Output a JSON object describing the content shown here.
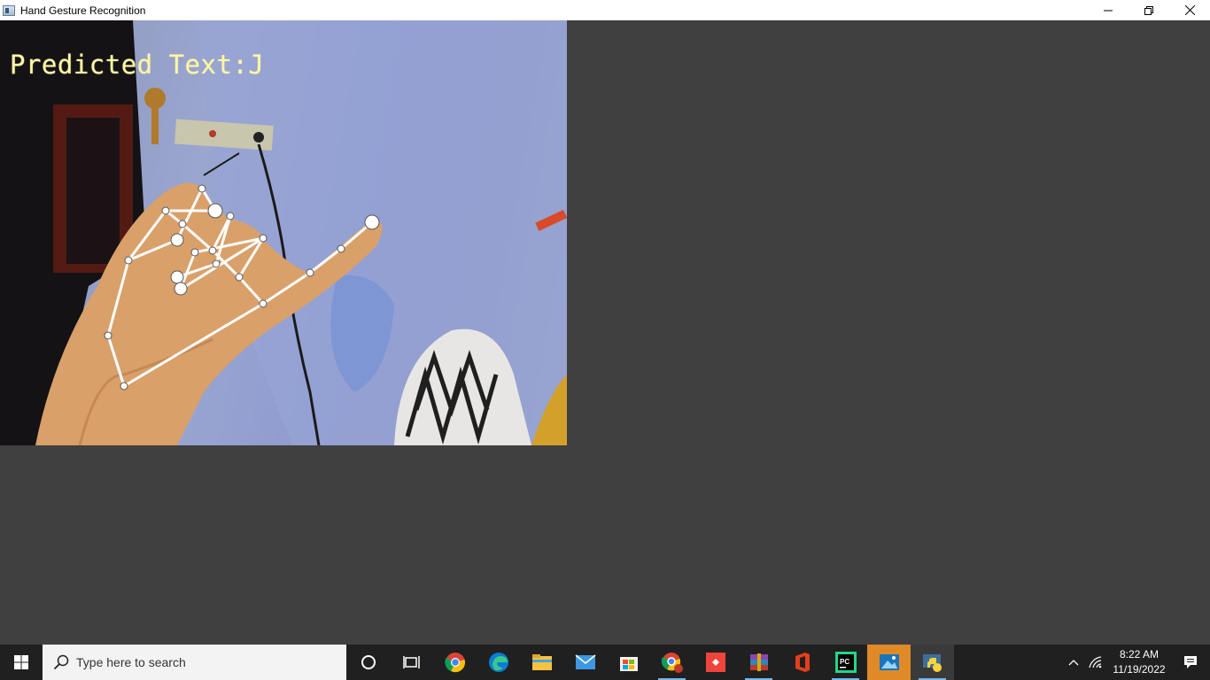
{
  "window": {
    "title": "Hand Gesture Recognition",
    "controls": [
      "minimize",
      "restore",
      "close"
    ]
  },
  "camera": {
    "predicted_label": "Predicted Text:J"
  },
  "taskbar": {
    "search_placeholder": "Type here to search",
    "pinned_apps": [
      "cortana",
      "task-view",
      "chrome",
      "edge",
      "file-explorer",
      "mail",
      "microsoft-store",
      "chrome-profile",
      "anydesk",
      "winrar",
      "office",
      "pycharm",
      "photos",
      "python"
    ],
    "clock_time": "8:22 AM",
    "clock_date": "11/19/2022"
  },
  "colors": {
    "background": "#404040",
    "taskbar": "#202020",
    "predicted_text": "#fff6a8",
    "active_app_highlight": "#e08a27",
    "running_indicator": "#76b9ed"
  }
}
